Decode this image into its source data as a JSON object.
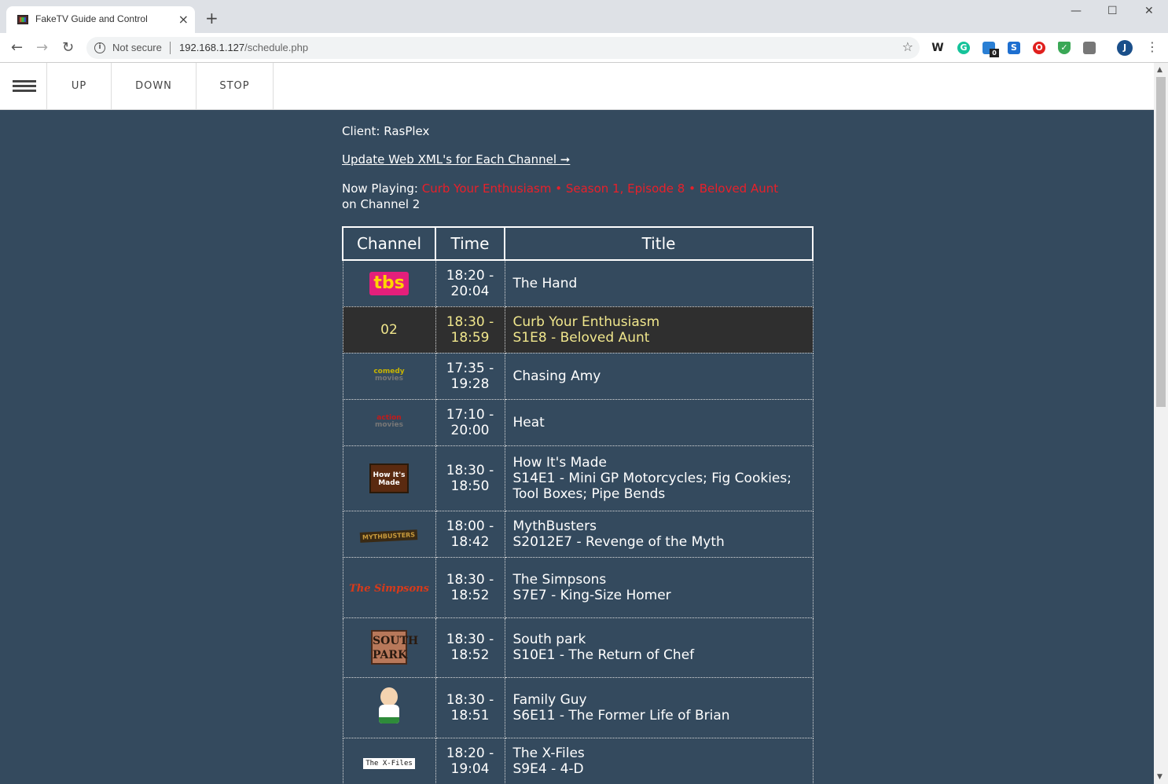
{
  "browser": {
    "tab_title": "FakeTV Guide and Control",
    "security_label": "Not secure",
    "url_host": "192.168.1.127",
    "url_path": "/schedule.php",
    "extensions_badge": "0",
    "profile_initial": "J"
  },
  "nav": {
    "up": "UP",
    "down": "DOWN",
    "stop": "STOP"
  },
  "client_label": "Client: RasPlex",
  "update_link": "Update Web XML's for Each Channel ➞",
  "now_playing": {
    "prefix": "Now Playing: ",
    "title": "Curb Your Enthusiasm • Season 1, Episode 8 • Beloved Aunt",
    "suffix": " on Channel 2"
  },
  "table": {
    "headers": [
      "Channel",
      "Time",
      "Title"
    ],
    "rows": [
      {
        "channel_text": "tbs",
        "logo": "tbs-logo",
        "start": "18:20 -",
        "end": "20:04",
        "title": "The Hand",
        "episode": ""
      },
      {
        "channel_text": "02",
        "logo": "",
        "start": "18:30 -",
        "end": "18:59",
        "title": "Curb Your Enthusiasm",
        "episode": "S1E8 - Beloved Aunt"
      },
      {
        "channel_text": "comedy",
        "channel_sub": "movies",
        "logo": "comedy-movies-logo",
        "start": "17:35 -",
        "end": "19:28",
        "title": "Chasing Amy",
        "episode": ""
      },
      {
        "channel_text": "action",
        "channel_sub": "movies",
        "logo": "action-movies-logo",
        "start": "17:10 -",
        "end": "20:00",
        "title": "Heat",
        "episode": ""
      },
      {
        "channel_text": "How It's Made",
        "logo": "how-its-made-logo",
        "start": "18:30 -",
        "end": "18:50",
        "title": "How It's Made",
        "episode": "S14E1 - Mini GP Motorcycles; Fig Cookies; Tool Boxes; Pipe Bends"
      },
      {
        "channel_text": "MYTHBUSTERS",
        "logo": "mythbusters-logo",
        "start": "18:00 -",
        "end": "18:42",
        "title": "MythBusters",
        "episode": "S2012E7 - Revenge of the Myth"
      },
      {
        "channel_text": "The Simpsons",
        "logo": "simpsons-logo",
        "start": "18:30 -",
        "end": "18:52",
        "title": "The Simpsons",
        "episode": "S7E7 - King-Size Homer"
      },
      {
        "channel_text": "SOUTH PARK",
        "logo": "south-park-logo",
        "start": "18:30 -",
        "end": "18:52",
        "title": "South park",
        "episode": "S10E1 - The Return of Chef"
      },
      {
        "channel_text": "",
        "logo": "family-guy-logo",
        "start": "18:30 -",
        "end": "18:51",
        "title": "Family Guy",
        "episode": "S6E11 - The Former Life of Brian"
      },
      {
        "channel_text": "The X-Files",
        "logo": "x-files-logo",
        "start": "18:20 -",
        "end": "19:04",
        "title": "The X-Files",
        "episode": "S9E4 - 4-D"
      }
    ]
  },
  "colors": {
    "page_bg": "#344a5e",
    "now_playing_red": "#e8202a",
    "highlight_row_bg": "#2f2f2f",
    "highlight_row_text": "#f0e68c"
  }
}
